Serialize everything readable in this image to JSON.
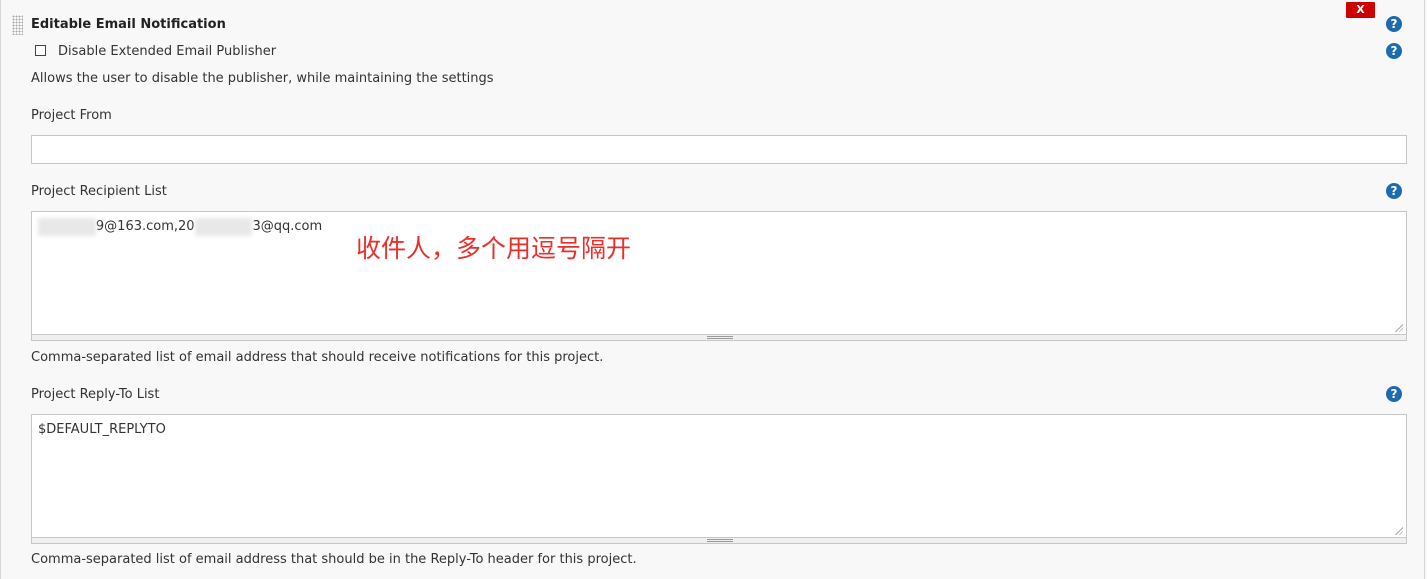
{
  "section": {
    "title": "Editable Email Notification",
    "delete_label": "X"
  },
  "help_icon": "?",
  "disable_publisher": {
    "label": "Disable Extended Email Publisher",
    "checked": false,
    "description": "Allows the user to disable the publisher, while maintaining the settings"
  },
  "project_from": {
    "label": "Project From",
    "value": ""
  },
  "recipient_list": {
    "label": "Project Recipient List",
    "value_part1_masked": "1870041",
    "value_part1": "9@163.com,20",
    "value_part2_masked": "1234567",
    "value_part2": "3@qq.com",
    "description": "Comma-separated list of email address that should receive notifications for this project."
  },
  "annotation": "收件人，多个用逗号隔开",
  "reply_to_list": {
    "label": "Project Reply-To List",
    "value": "$DEFAULT_REPLYTO",
    "description": "Comma-separated list of email address that should be in the Reply-To header for this project."
  },
  "colors": {
    "delete_button": "#cc0000",
    "help_icon": "#1d6ab0",
    "annotation": "#e8302a"
  }
}
